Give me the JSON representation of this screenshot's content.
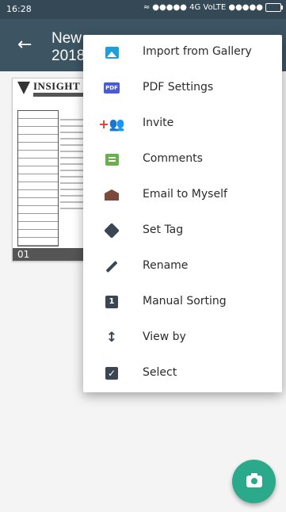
{
  "status_bar": {
    "time": "16:28",
    "signal_text": "●●●●● 4G VoLTE ●●●●●"
  },
  "app_bar": {
    "title_line1": "New",
    "title_line2": "2018"
  },
  "thumbnail": {
    "doc_title": "INSIGHT",
    "page_number": "01"
  },
  "menu": {
    "items": [
      {
        "label": "Import from Gallery",
        "icon": "gallery-icon",
        "color": "#1e9fd8"
      },
      {
        "label": "PDF Settings",
        "icon": "pdf-icon",
        "icon_text": "PDF",
        "color": "#4b5bd6"
      },
      {
        "label": "Invite",
        "icon": "invite-icon",
        "icon_text": "+👥",
        "color": "#e53935"
      },
      {
        "label": "Comments",
        "icon": "comment-icon",
        "color": "#6ab04c"
      },
      {
        "label": "Email to Myself",
        "icon": "email-icon",
        "color": "#7a4a3a"
      },
      {
        "label": "Set Tag",
        "icon": "tag-icon",
        "color": "#3a4652"
      },
      {
        "label": "Rename",
        "icon": "pencil-icon",
        "color": "#3a4652"
      },
      {
        "label": "Manual Sorting",
        "icon": "sort-icon",
        "icon_text": "1",
        "color": "#3a4652"
      },
      {
        "label": "View by",
        "icon": "view-by-icon",
        "icon_text": "↕",
        "color": "#3a4652"
      },
      {
        "label": "Select",
        "icon": "checkbox-icon",
        "icon_text": "✓",
        "color": "#3a4652"
      }
    ]
  },
  "colors": {
    "status_bar": "#354856",
    "app_bar": "#3d5462",
    "fab": "#2aaa8a"
  },
  "fab": {
    "icon": "camera-icon"
  }
}
